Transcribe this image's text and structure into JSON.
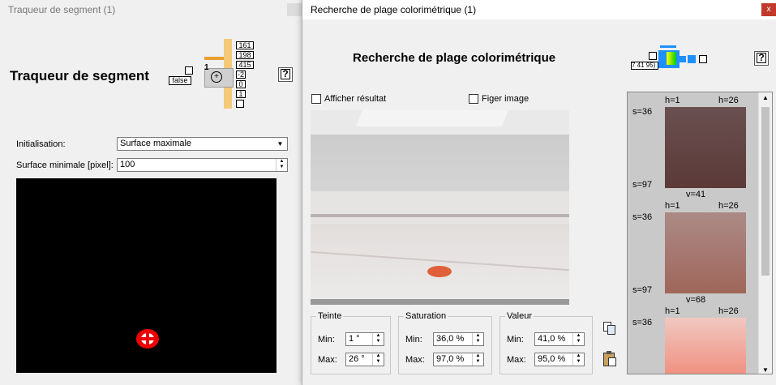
{
  "left_window": {
    "title_bar": "Traqueur de segment (1)",
    "heading": "Traqueur de segment",
    "node_values": [
      "161",
      "198",
      "415",
      "-2",
      "0",
      "1"
    ],
    "false_label": "false",
    "counter_label": "1",
    "init_label": "Initialisation:",
    "init_value": "Surface maximale",
    "min_surface_label": "Surface minimale [pixel]:",
    "min_surface_value": "100"
  },
  "right_window": {
    "title_bar": "Recherche de plage colorimétrique (1)",
    "close_label": "x",
    "heading": "Recherche de plage colorimétrique",
    "node_label": "7 41 95)",
    "show_result_label": "Afficher résultat",
    "freeze_label": "Figer image",
    "teinte": {
      "title": "Teinte",
      "min_label": "Min:",
      "min": "1 °",
      "max_label": "Max:",
      "max": "26 °"
    },
    "saturation": {
      "title": "Saturation",
      "min_label": "Min:",
      "min": "36,0 %",
      "max_label": "Max:",
      "max": "97,0 %"
    },
    "valeur": {
      "title": "Valeur",
      "min_label": "Min:",
      "min": "41,0 %",
      "max_label": "Max:",
      "max": "95,0 %"
    },
    "swatches": [
      {
        "h_start": "h=1",
        "h_end": "h=26",
        "s_top": "s=36",
        "s_bottom": "s=97",
        "v": "v=41"
      },
      {
        "h_start": "h=1",
        "h_end": "h=26",
        "s_top": "s=36",
        "s_bottom": "s=97",
        "v": "v=68"
      },
      {
        "h_start": "h=1",
        "h_end": "h=26",
        "s_top": "s=36"
      }
    ]
  },
  "colors": {
    "accent_node": "#f5c97a",
    "node_blue": "#1e90ff",
    "close_red": "#c0392b"
  }
}
